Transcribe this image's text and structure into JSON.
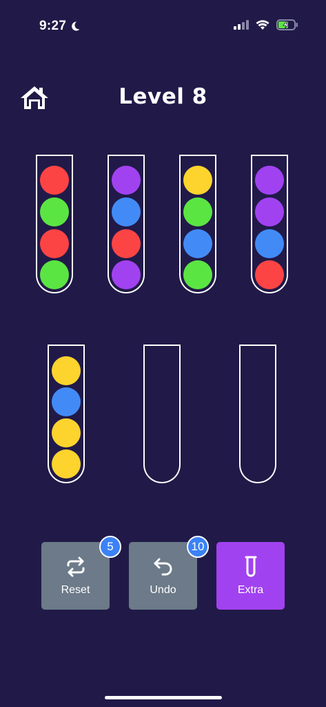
{
  "status_bar": {
    "time": "9:27"
  },
  "header": {
    "title": "Level 8"
  },
  "colors": {
    "red": "#fd4445",
    "green": "#5be542",
    "blue": "#428bf6",
    "purple": "#a142f0",
    "yellow": "#fdd42d",
    "reset_button_bg": "#6c7a89",
    "undo_button_bg": "#6c7a89",
    "extra_button_bg": "#a142f0",
    "badge_bg": "#3b82f6"
  },
  "tubes_row1": [
    {
      "balls": [
        "red",
        "green",
        "red",
        "green"
      ]
    },
    {
      "balls": [
        "purple",
        "blue",
        "red",
        "purple"
      ]
    },
    {
      "balls": [
        "yellow",
        "green",
        "blue",
        "green"
      ]
    },
    {
      "balls": [
        "purple",
        "purple",
        "blue",
        "red"
      ]
    }
  ],
  "tubes_row2": [
    {
      "balls": [
        "yellow",
        "blue",
        "yellow",
        "yellow"
      ]
    },
    {
      "balls": []
    },
    {
      "balls": []
    }
  ],
  "buttons": {
    "reset": {
      "label": "Reset",
      "badge": "5",
      "icon": "repeat-icon"
    },
    "undo": {
      "label": "Undo",
      "badge": "10",
      "icon": "undo-icon"
    },
    "extra": {
      "label": "Extra",
      "icon": "test-tube-icon"
    }
  }
}
